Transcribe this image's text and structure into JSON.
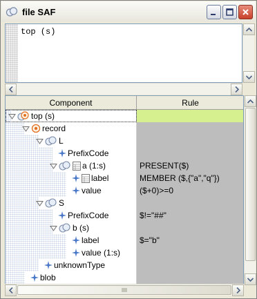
{
  "window": {
    "title": "file SAF"
  },
  "editor": {
    "text": "top (s)"
  },
  "table": {
    "headers": {
      "component": "Component",
      "rule": "Rule"
    },
    "rows": [
      {
        "label": "top (s)",
        "rule": "",
        "depth": 0,
        "icon": "root-target-icon",
        "toggle": "expanded",
        "selected": true
      },
      {
        "label": "record",
        "rule": "",
        "depth": 1,
        "icon": "record-icon",
        "toggle": "expanded"
      },
      {
        "label": "L",
        "rule": "",
        "depth": 2,
        "icon": "sequence-icon",
        "toggle": "expanded"
      },
      {
        "label": "PrefixCode",
        "rule": "",
        "depth": 3,
        "icon": "diamond-icon",
        "toggle": "none"
      },
      {
        "label": "a (1:s)",
        "rule": "PRESENT($)",
        "depth": 3,
        "icon": "sequence-table-icon",
        "toggle": "expanded"
      },
      {
        "label": "label",
        "rule": "MEMBER ($,{\"a\",\"q\"})",
        "depth": 4,
        "icon": "diamond-table-icon",
        "toggle": "none"
      },
      {
        "label": "value",
        "rule": "($+0)>=0",
        "depth": 4,
        "icon": "diamond-icon",
        "toggle": "none"
      },
      {
        "label": "S",
        "rule": "",
        "depth": 2,
        "icon": "sequence-icon",
        "toggle": "expanded"
      },
      {
        "label": "PrefixCode",
        "rule": "$!=\"##\"",
        "depth": 3,
        "icon": "diamond-icon",
        "toggle": "none"
      },
      {
        "label": "b (s)",
        "rule": "",
        "depth": 3,
        "icon": "sequence-icon",
        "toggle": "expanded"
      },
      {
        "label": "label",
        "rule": "$=\"b\"",
        "depth": 4,
        "icon": "diamond-icon",
        "toggle": "none"
      },
      {
        "label": "value (1:s)",
        "rule": "",
        "depth": 4,
        "icon": "diamond-icon",
        "toggle": "none"
      },
      {
        "label": "unknownType",
        "rule": "",
        "depth": 2,
        "icon": "diamond-icon",
        "toggle": "none"
      },
      {
        "label": "blob",
        "rule": "",
        "depth": 1,
        "icon": "diamond-icon",
        "toggle": "none"
      }
    ]
  },
  "colors": {
    "selected_rule": "#d6f08f",
    "rule_cell": "#bdbdbd",
    "diamond": "#4a78c8",
    "record_orange": "#e07020"
  }
}
